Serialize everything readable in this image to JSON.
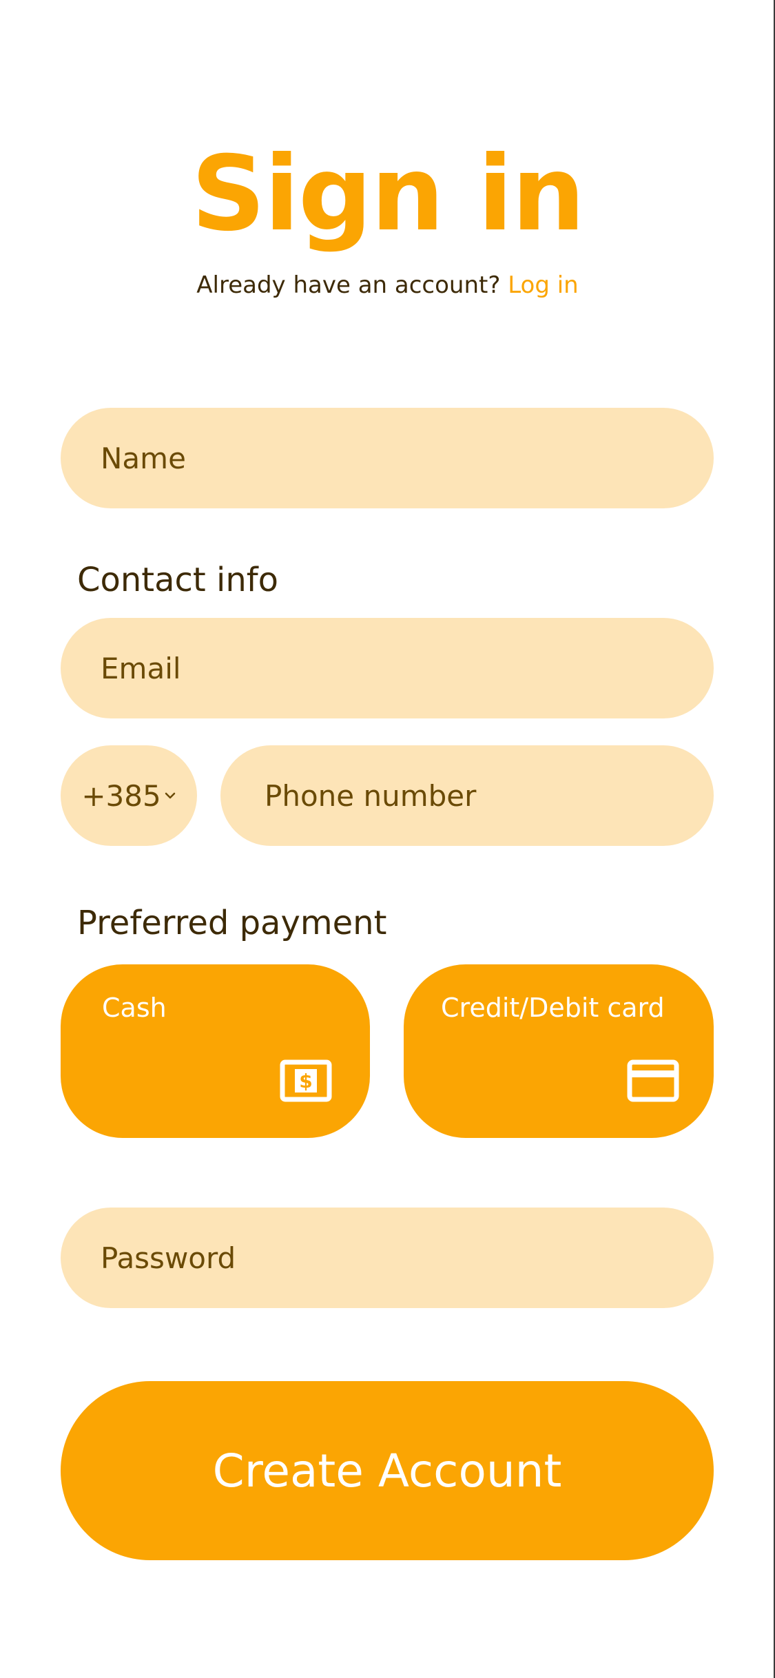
{
  "header": {
    "title": "Sign in",
    "subtitle_prefix": "Already have an account?",
    "login_link": "Log in"
  },
  "form": {
    "name_placeholder": "Name",
    "contact_label": "Contact info",
    "email_placeholder": "Email",
    "country_code": "+385",
    "phone_placeholder": "Phone number",
    "payment_label": "Preferred payment",
    "payment_options": [
      {
        "label": "Cash",
        "icon": "cash-icon"
      },
      {
        "label": "Credit/Debit card",
        "icon": "credit-card-icon"
      }
    ],
    "password_placeholder": "Password",
    "submit_label": "Create Account"
  },
  "colors": {
    "accent": "#FBA503",
    "field_bg": "#FDE4B7",
    "text_dark": "#3d2a07",
    "placeholder": "#6a4a06"
  }
}
